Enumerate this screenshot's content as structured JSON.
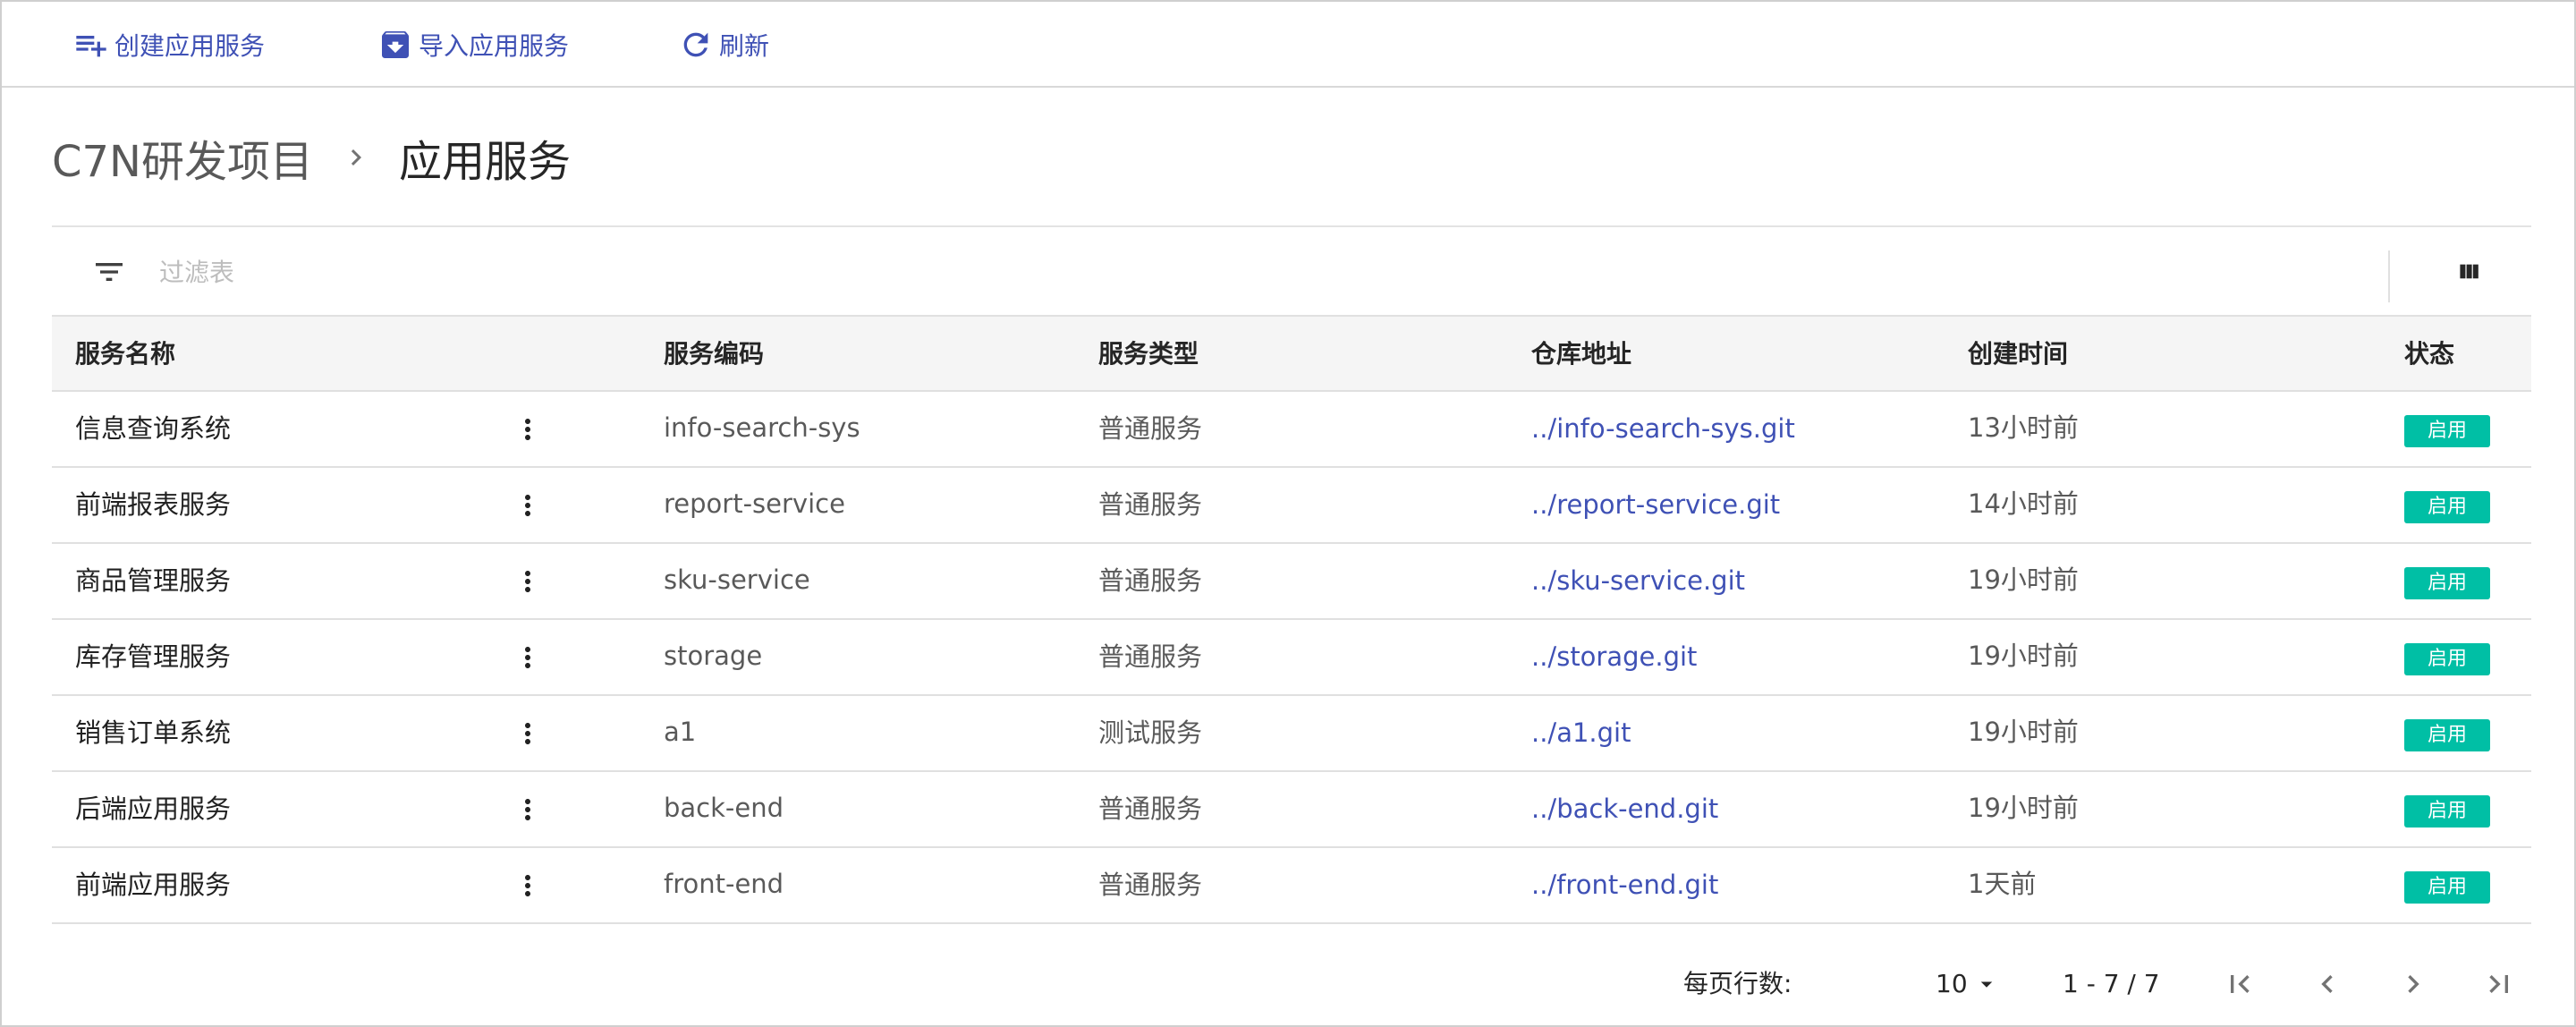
{
  "toolbar": {
    "create_label": "创建应用服务",
    "import_label": "导入应用服务",
    "refresh_label": "刷新"
  },
  "breadcrumb": {
    "project": "C7N研发项目",
    "current": "应用服务"
  },
  "filter": {
    "placeholder": "过滤表"
  },
  "table": {
    "headers": {
      "name": "服务名称",
      "code": "服务编码",
      "type": "服务类型",
      "repo": "仓库地址",
      "time": "创建时间",
      "status": "状态"
    },
    "rows": [
      {
        "name": "信息查询系统",
        "code": "info-search-sys",
        "type": "普通服务",
        "repo": "../info-search-sys.git",
        "time": "13小时前",
        "status": "启用"
      },
      {
        "name": "前端报表服务",
        "code": "report-service",
        "type": "普通服务",
        "repo": "../report-service.git",
        "time": "14小时前",
        "status": "启用"
      },
      {
        "name": "商品管理服务",
        "code": "sku-service",
        "type": "普通服务",
        "repo": "../sku-service.git",
        "time": "19小时前",
        "status": "启用"
      },
      {
        "name": "库存管理服务",
        "code": "storage",
        "type": "普通服务",
        "repo": "../storage.git",
        "time": "19小时前",
        "status": "启用"
      },
      {
        "name": "销售订单系统",
        "code": "a1",
        "type": "测试服务",
        "repo": "../a1.git",
        "time": "19小时前",
        "status": "启用"
      },
      {
        "name": "后端应用服务",
        "code": "back-end",
        "type": "普通服务",
        "repo": "../back-end.git",
        "time": "19小时前",
        "status": "启用"
      },
      {
        "name": "前端应用服务",
        "code": "front-end",
        "type": "普通服务",
        "repo": "../front-end.git",
        "time": "1天前",
        "status": "启用"
      }
    ]
  },
  "pagination": {
    "rows_label": "每页行数:",
    "page_size": "10",
    "range": "1 - 7 / 7"
  },
  "colors": {
    "accent": "#3f51b5",
    "status_enabled": "#00bfa5",
    "header_bg": "#f5f5f5"
  },
  "icons": [
    "playlist-add-icon",
    "archive-import-icon",
    "refresh-icon",
    "chevron-right-icon",
    "filter-icon",
    "view-column-icon",
    "more-vert-icon",
    "dropdown-arrow-icon",
    "first-page-icon",
    "prev-page-icon",
    "next-page-icon",
    "last-page-icon"
  ]
}
